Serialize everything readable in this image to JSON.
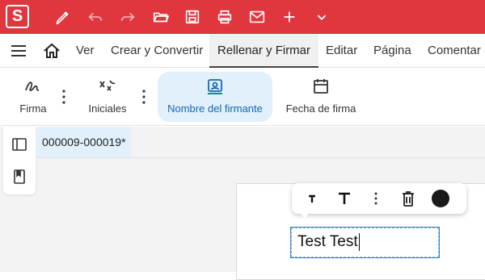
{
  "app": {
    "logo_letter": "S",
    "accent": "#e0363e",
    "quick_access": [
      "pen-icon",
      "undo-icon",
      "redo-icon",
      "open-folder-icon",
      "save-icon",
      "print-icon",
      "mail-icon",
      "plus-icon",
      "chevron-down-icon"
    ]
  },
  "menu": {
    "items": [
      {
        "label": "Ver",
        "active": false
      },
      {
        "label": "Crear y Convertir",
        "active": false
      },
      {
        "label": "Rellenar y Firmar",
        "active": true
      },
      {
        "label": "Editar",
        "active": false
      },
      {
        "label": "Página",
        "active": false
      },
      {
        "label": "Comentar",
        "active": false
      }
    ]
  },
  "ribbon": {
    "buttons": [
      {
        "label": "Firma",
        "icon": "signature-icon",
        "active": false
      },
      {
        "label": "Iniciales",
        "icon": "initials-icon",
        "active": false
      },
      {
        "label": "Nombre del firmante",
        "icon": "signer-name-icon",
        "active": true
      },
      {
        "label": "Fecha de firma",
        "icon": "calendar-icon",
        "active": false
      }
    ]
  },
  "document": {
    "tab_label": "000009-000019*"
  },
  "text_field": {
    "value": "Test Test"
  },
  "float_toolbar": {
    "tools": [
      "decrease-font-icon",
      "increase-font-icon",
      "more-icon",
      "delete-icon",
      "color-swatch"
    ],
    "color": "#1a1a1a"
  }
}
